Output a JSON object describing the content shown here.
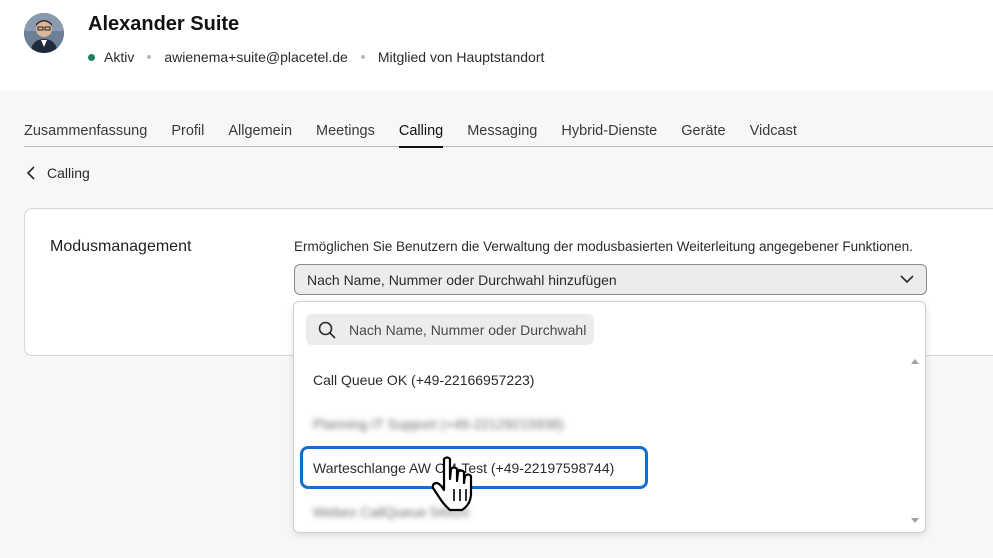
{
  "user": {
    "name": "Alexander Suite",
    "status": "Aktiv",
    "email": "awienema+suite@placetel.de",
    "membership": "Mitglied von Hauptstandort"
  },
  "tabs": [
    {
      "label": "Zusammenfassung",
      "active": false
    },
    {
      "label": "Profil",
      "active": false
    },
    {
      "label": "Allgemein",
      "active": false
    },
    {
      "label": "Meetings",
      "active": false
    },
    {
      "label": "Calling",
      "active": true
    },
    {
      "label": "Messaging",
      "active": false
    },
    {
      "label": "Hybrid-Dienste",
      "active": false
    },
    {
      "label": "Geräte",
      "active": false
    },
    {
      "label": "Vidcast",
      "active": false
    }
  ],
  "breadcrumb": {
    "back_label": "Calling"
  },
  "section": {
    "title": "Modusmanagement",
    "description": "Ermöglichen Sie Benutzern die Verwaltung der modusbasierten Weiterleitung angegebener Funktionen.",
    "select_placeholder": "Nach Name, Nummer oder Durchwahl hinzufügen"
  },
  "dropdown": {
    "search_placeholder": "Nach Name, Nummer oder Durchwahl hinzufügen",
    "options": [
      {
        "label": "Call Queue OK (+49-22166957223)",
        "blurred": false
      },
      {
        "label": "Planning IT Support (+49-22129215938)",
        "blurred": true
      },
      {
        "label": "Warteschlange AW CM-Test (+49-22197598744)",
        "blurred": false,
        "highlighted": true
      },
      {
        "label": "Webex CallQueue 54920",
        "blurred": true
      }
    ]
  },
  "colors": {
    "status_active": "#1d8160",
    "highlight_border": "#1170cf"
  },
  "icons": {
    "back": "chevron-left-icon",
    "select": "chevron-down-icon",
    "search": "search-icon",
    "cursor": "hand-pointer-icon"
  }
}
